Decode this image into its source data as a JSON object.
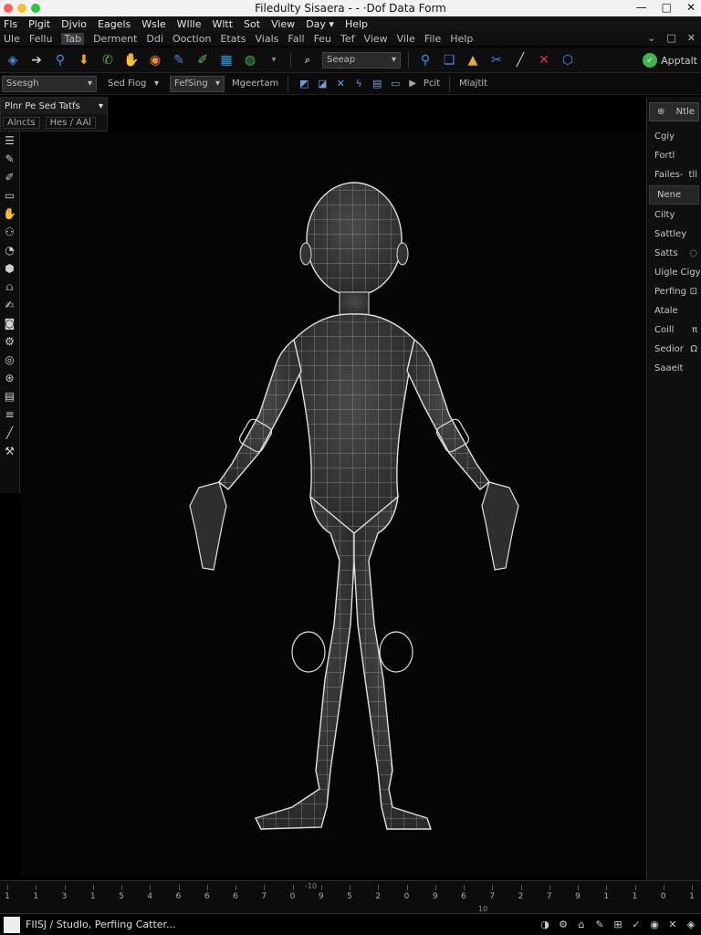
{
  "title_bar": {
    "title": "Filedulty Sisaera - - ·Dof Data Form",
    "dot_colors": [
      "#ff5f57",
      "#febc2e",
      "#28c840"
    ],
    "min_glyph": "—",
    "max_glyph": "□",
    "close_glyph": "✕"
  },
  "menu_primary": [
    "Fls",
    "Plgit",
    "Djvio",
    "Eagels",
    "Wsle",
    "Wllle",
    "Wltt",
    "Sot",
    "View",
    "Day ▾",
    "Help"
  ],
  "menu_secondary": {
    "items": [
      "Ule",
      "Fellu",
      "Tab",
      "Derment",
      "Ddi",
      "Ooction",
      "Etats",
      "Vials",
      "Fall",
      "Feu",
      "Tef",
      "View",
      "Vile",
      "File",
      "Help"
    ],
    "selected_index": 2,
    "right": [
      "⌄",
      "□",
      "✕"
    ]
  },
  "toolbar": {
    "icons": [
      {
        "name": "select-icon",
        "glyph": "◈",
        "color": "#4a8be0"
      },
      {
        "name": "arrow-icon",
        "glyph": "➔",
        "color": "#cccccc"
      },
      {
        "name": "search-icon",
        "glyph": "⚲",
        "color": "#4a8be0"
      },
      {
        "name": "import-icon",
        "glyph": "⬇",
        "color": "#e8a020"
      },
      {
        "name": "phone-icon",
        "glyph": "✆",
        "color": "#3cb84a"
      },
      {
        "name": "hand-icon",
        "glyph": "✋",
        "color": "#e8a020"
      },
      {
        "name": "target-icon",
        "glyph": "◉",
        "color": "#ff8c1a"
      },
      {
        "name": "pencil-icon",
        "glyph": "✎",
        "color": "#4a8be0"
      },
      {
        "name": "brush-icon",
        "glyph": "✐",
        "color": "#6ac04a"
      },
      {
        "name": "grid-icon",
        "glyph": "▦",
        "color": "#20a8e0"
      },
      {
        "name": "globe-icon",
        "glyph": "◍",
        "color": "#3cb84a"
      }
    ],
    "dropdown_arrow": "▾",
    "search_glyph": "⌕",
    "search_dropdown": "Seeap",
    "right_icons": [
      {
        "name": "magnify-icon",
        "glyph": "⚲",
        "color": "#4a8be0"
      },
      {
        "name": "layers-icon",
        "glyph": "❏",
        "color": "#4a8be0"
      },
      {
        "name": "warning-icon",
        "glyph": "▲",
        "color": "#e8b020"
      },
      {
        "name": "tools-icon",
        "glyph": "✂",
        "color": "#4a8be0"
      },
      {
        "name": "knife-icon",
        "glyph": "╱",
        "color": "#cccccc"
      },
      {
        "name": "delete-icon",
        "glyph": "✕",
        "color": "#e03030"
      },
      {
        "name": "cube-icon",
        "glyph": "⬡",
        "color": "#4a8be0"
      }
    ],
    "app_button": "Apptalt",
    "app_check": "✓"
  },
  "options_bar": {
    "dropdown_1": "Ssesgh",
    "dropdown_2": "Sed Fiog",
    "dropdown_3": "FefSing",
    "label_1": "Mgeertam",
    "label_2": "Pcit",
    "label_3": "Mlajtlt",
    "play_glyph": "▶",
    "icons": [
      {
        "name": "move-icon",
        "glyph": "◩"
      },
      {
        "name": "rotate-icon",
        "glyph": "◪"
      },
      {
        "name": "scale-icon",
        "glyph": "✕"
      },
      {
        "name": "curve-icon",
        "glyph": "ϟ"
      },
      {
        "name": "page-icon",
        "glyph": "▤"
      },
      {
        "name": "frame-icon",
        "glyph": "▭"
      }
    ]
  },
  "outliner": {
    "title": "Plnr Pe Sed Tatfs",
    "arrow": "▾",
    "tabs": [
      "Alncts",
      "Hes / AAl"
    ]
  },
  "left_tools": [
    "☰",
    "✎",
    "✐",
    "▭",
    "✋",
    "⚇",
    "◔",
    "⬢",
    "⩍",
    "✍",
    "◙",
    "⚙",
    "◎",
    "⊛",
    "▤",
    "≡",
    "╱",
    "⚒"
  ],
  "right_panel": {
    "items": [
      {
        "label": "Ntle",
        "glyph": "⊕",
        "style": "top"
      },
      {
        "label": "Cgiy",
        "suffix": "",
        "style": ""
      },
      {
        "label": "Fortl",
        "suffix": "",
        "style": ""
      },
      {
        "label": "Failes-",
        "suffix": "tll",
        "style": ""
      },
      {
        "label": "Nene",
        "suffix": "",
        "style": "hl"
      },
      {
        "label": "Cilty",
        "suffix": "",
        "style": ""
      },
      {
        "label": "Sattley",
        "suffix": "",
        "style": ""
      },
      {
        "label": "Satts",
        "suffix": "◌",
        "style": ""
      },
      {
        "label": "Uigle Cigy",
        "suffix": "",
        "style": ""
      },
      {
        "label": "Perfing",
        "suffix": "⊡",
        "style": ""
      },
      {
        "label": "Atale",
        "suffix": "",
        "style": ""
      },
      {
        "label": "Coill",
        "suffix": "π",
        "style": ""
      },
      {
        "label": "Sedior",
        "suffix": "Ω",
        "style": ""
      },
      {
        "label": "Saaeit",
        "suffix": "",
        "style": ""
      }
    ]
  },
  "timeline": {
    "ticks": [
      "1",
      "1",
      "3",
      "1",
      "5",
      "4",
      "6",
      "6",
      "6",
      "7",
      "0",
      "9",
      "5",
      "2",
      "0",
      "9",
      "6",
      "7",
      "2",
      "7",
      "9",
      "1",
      "1",
      "0",
      "1"
    ],
    "marker": "-10",
    "marker_2": "10"
  },
  "status_bar": {
    "text": "FIISJ / Studlo, Perfiing Catter...",
    "icons": [
      "◑",
      "⚙",
      "⌂",
      "✎",
      "⊞",
      "✓",
      "◉",
      "✕",
      "◈"
    ]
  }
}
